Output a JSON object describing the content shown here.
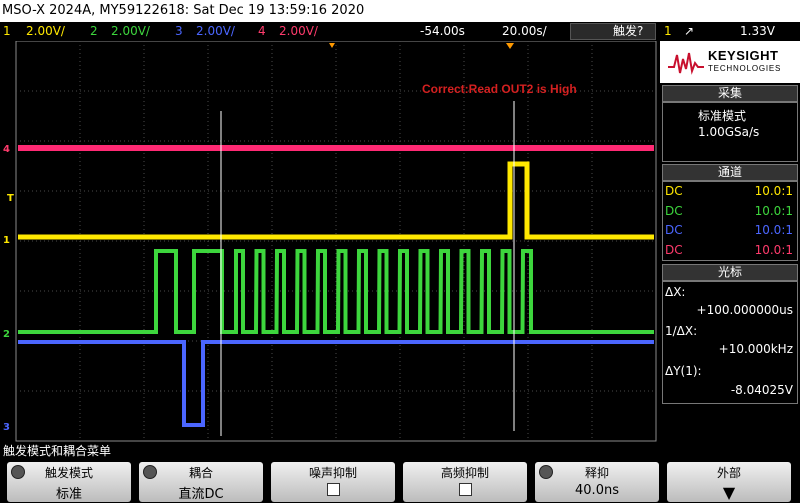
{
  "title": "MSO-X 2024A, MY59122618: Sat Dec 19 13:59:16 2020",
  "status": {
    "ch1": {
      "num": "1",
      "scale": "2.00V/",
      "color": "#ffe800"
    },
    "ch2": {
      "num": "2",
      "scale": "2.00V/",
      "color": "#3dd63d"
    },
    "ch3": {
      "num": "3",
      "scale": "2.00V/",
      "color": "#4b66ff"
    },
    "ch4": {
      "num": "4",
      "scale": "2.00V/",
      "color": "#ff3b6c"
    },
    "time_offset": "-54.00s",
    "time_scale": "20.00s/",
    "trigger_label": "触发?",
    "trigger_channel": "1",
    "trigger_level": "1.33V"
  },
  "logo": {
    "name": "KEYSIGHT",
    "sub": "TECHNOLOGIES"
  },
  "acquire": {
    "header": "采集",
    "mode": "标准模式",
    "rate": "1.00GSa/s"
  },
  "channels": {
    "header": "通道",
    "rows": [
      {
        "coupling": "DC",
        "probe": "10.0:1",
        "color": "#ffe800"
      },
      {
        "coupling": "DC",
        "probe": "10.0:1",
        "color": "#3dd63d"
      },
      {
        "coupling": "DC",
        "probe": "10.0:1",
        "color": "#4b66ff"
      },
      {
        "coupling": "DC",
        "probe": "10.0:1",
        "color": "#ff3b6c"
      }
    ]
  },
  "cursors": {
    "header": "光标",
    "dx_label": "ΔX:",
    "dx_value": "+100.000000us",
    "inv_label": "1/ΔX:",
    "inv_value": "+10.000kHz",
    "dy_label": "ΔY(1):",
    "dy_value": "-8.04025V"
  },
  "annotation": "Correct:Read OUT2 is High",
  "menu_title": "触发模式和耦合菜单",
  "softkeys": [
    {
      "label": "触发模式",
      "value": "标准",
      "knob": true
    },
    {
      "label": "耦合",
      "value": "直流DC",
      "knob": true
    },
    {
      "label": "噪声抑制",
      "value": "",
      "checkbox": true
    },
    {
      "label": "高频抑制",
      "value": "",
      "checkbox": true
    },
    {
      "label": "释抑",
      "value": "40.0ns",
      "knob": true
    },
    {
      "label": "外部",
      "value": "",
      "arrow": true
    }
  ],
  "channel_markers": [
    "4",
    "T",
    "1",
    "2",
    "3"
  ]
}
